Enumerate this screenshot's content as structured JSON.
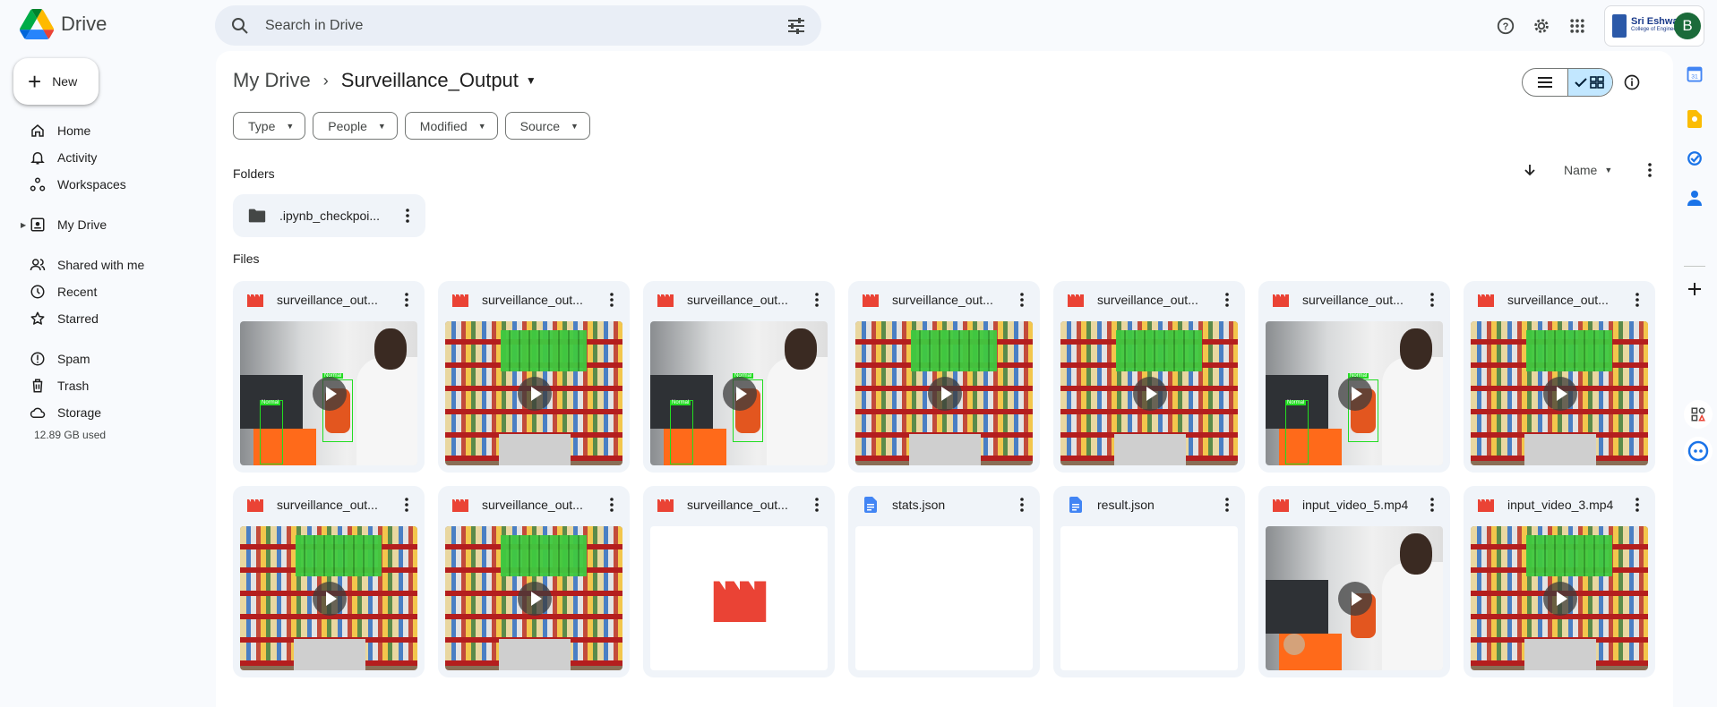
{
  "app": {
    "name": "Drive",
    "search_placeholder": "Search in Drive",
    "org_name": "Sri Eshwar",
    "org_sub": "College of Engineering",
    "avatar_letter": "B"
  },
  "new_button": {
    "label": "New"
  },
  "sidebar": {
    "items": [
      {
        "label": "Home",
        "icon": "home-icon"
      },
      {
        "label": "Activity",
        "icon": "bell-icon"
      },
      {
        "label": "Workspaces",
        "icon": "workspaces-icon"
      },
      {
        "label": "My Drive",
        "icon": "my-drive-icon"
      },
      {
        "label": "Shared with me",
        "icon": "shared-icon"
      },
      {
        "label": "Recent",
        "icon": "clock-icon"
      },
      {
        "label": "Starred",
        "icon": "star-icon"
      },
      {
        "label": "Spam",
        "icon": "spam-icon"
      },
      {
        "label": "Trash",
        "icon": "trash-icon"
      },
      {
        "label": "Storage",
        "icon": "cloud-icon"
      }
    ],
    "storage_used": "12.89 GB used"
  },
  "breadcrumb": {
    "root": "My Drive",
    "current": "Surveillance_Output"
  },
  "filters": [
    "Type",
    "People",
    "Modified",
    "Source"
  ],
  "sections": {
    "folders": "Folders",
    "files": "Files"
  },
  "sort": {
    "label": "Name"
  },
  "folders": [
    {
      "name": ".ipynb_checkpoi..."
    }
  ],
  "files": [
    {
      "name": "surveillance_out...",
      "kind": "video",
      "thumb": "person"
    },
    {
      "name": "surveillance_out...",
      "kind": "video",
      "thumb": "store"
    },
    {
      "name": "surveillance_out...",
      "kind": "video",
      "thumb": "person"
    },
    {
      "name": "surveillance_out...",
      "kind": "video",
      "thumb": "store"
    },
    {
      "name": "surveillance_out...",
      "kind": "video",
      "thumb": "store"
    },
    {
      "name": "surveillance_out...",
      "kind": "video",
      "thumb": "person"
    },
    {
      "name": "surveillance_out...",
      "kind": "video",
      "thumb": "store"
    },
    {
      "name": "surveillance_out...",
      "kind": "video",
      "thumb": "store"
    },
    {
      "name": "surveillance_out...",
      "kind": "video",
      "thumb": "store"
    },
    {
      "name": "surveillance_out...",
      "kind": "video",
      "thumb": "icon"
    },
    {
      "name": "stats.json",
      "kind": "doc",
      "thumb": "blank"
    },
    {
      "name": "result.json",
      "kind": "doc",
      "thumb": "blank"
    },
    {
      "name": "input_video_5.mp4",
      "kind": "video",
      "thumb": "person2"
    },
    {
      "name": "input_video_3.mp4",
      "kind": "video",
      "thumb": "store"
    }
  ],
  "colors": {
    "video_icon": "#ea4335",
    "doc_icon": "#4285f4",
    "accent": "#c2e7ff"
  }
}
